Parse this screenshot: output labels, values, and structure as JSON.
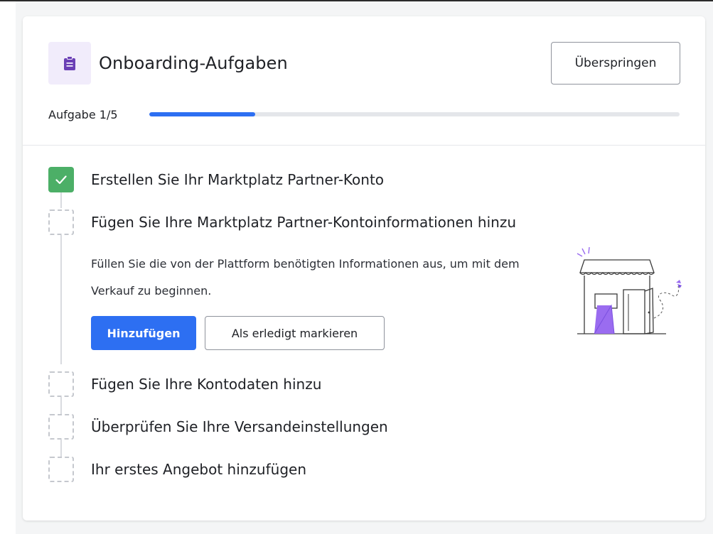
{
  "onboarding": {
    "title": "Onboarding-Aufgaben",
    "skip_label": "Überspringen",
    "progress": {
      "label": "Aufgabe 1/5",
      "fraction": 0.2
    },
    "steps": [
      {
        "label": "Erstellen Sie Ihr Marktplatz Partner-Konto",
        "status": "done"
      },
      {
        "label": "Fügen Sie Ihre Marktplatz Partner-Kontoinformationen hinzu",
        "status": "active",
        "description": "Füllen Sie die von der Plattform benötigten Informationen aus, um mit dem Verkauf zu beginnen.",
        "primary_action": "Hinzufügen",
        "secondary_action": "Als erledigt markieren"
      },
      {
        "label": "Fügen Sie Ihre Kontodaten hinzu",
        "status": "pending"
      },
      {
        "label": "Überprüfen Sie Ihre Versandeinstellungen",
        "status": "pending"
      },
      {
        "label": "Ihr erstes Angebot hinzufügen",
        "status": "pending"
      }
    ]
  },
  "colors": {
    "accent": "#2d6ff2",
    "done": "#4caf67",
    "icon_purple": "#6a3fb5",
    "illustration_purple": "#9a6cf0"
  },
  "icons": {
    "header": "clipboard-icon",
    "done": "checkmark-icon",
    "illustration": "storefront-illustration"
  }
}
